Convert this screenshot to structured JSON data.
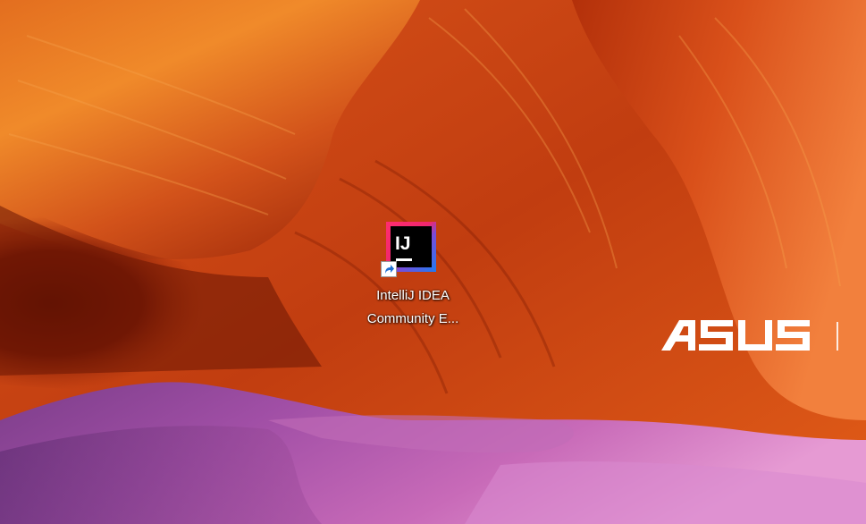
{
  "desktop": {
    "icons": [
      {
        "label_line1": "IntelliJ IDEA",
        "label_line2": "Community E...",
        "glyph": "IJ",
        "icon_name": "intellij-idea-icon",
        "is_shortcut": true
      }
    ],
    "wallpaper": {
      "brand": "ASUS",
      "colors": {
        "rock_orange": "#e35a16",
        "rock_deep": "#8a1d05",
        "sand_purple": "#b357b4",
        "sand_pink": "#e58bcf"
      }
    }
  }
}
